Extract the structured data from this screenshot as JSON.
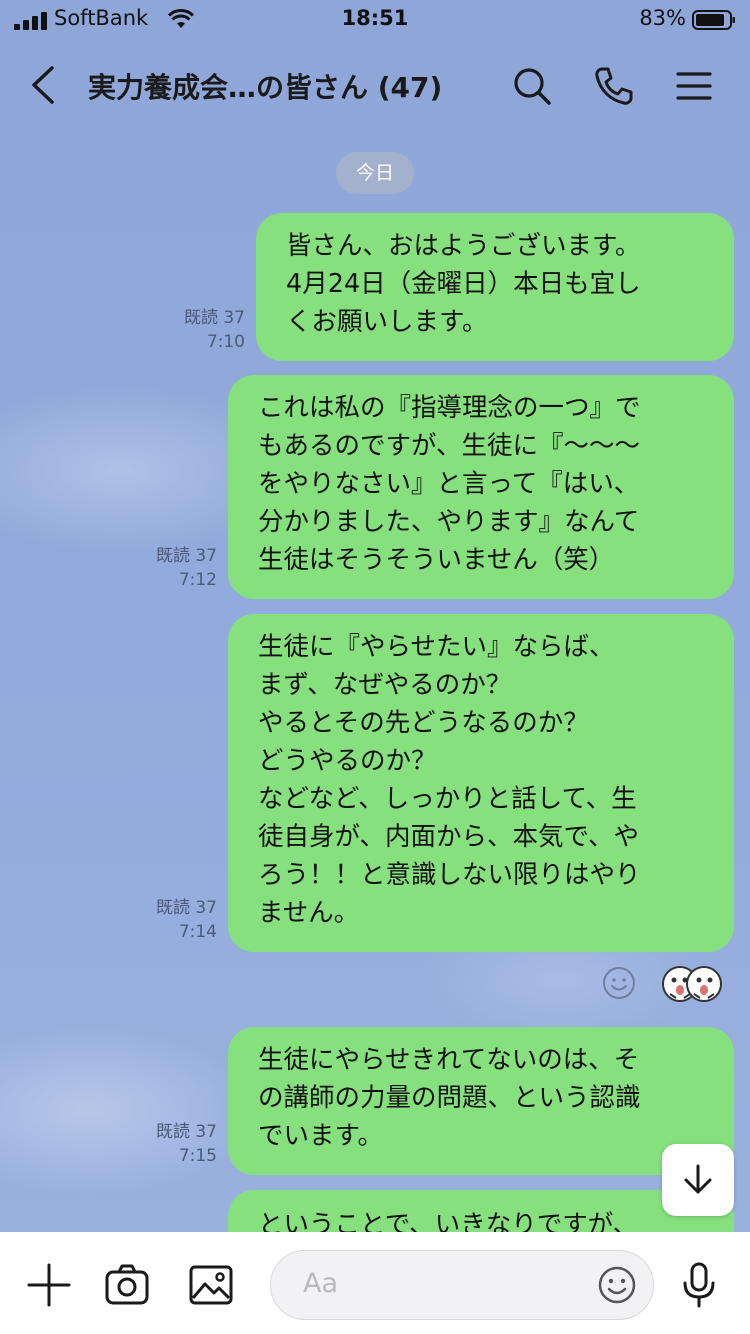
{
  "status_bar": {
    "carrier": "SoftBank",
    "time": "18:51",
    "battery": "83%"
  },
  "header": {
    "title": "実力養成会…の皆さん (47)"
  },
  "date_separator": "今日",
  "messages": [
    {
      "text": "皆さん、おはようございます。\n4月24日（金曜日）本日も宜し\nくお願いします。",
      "read": "既読 37",
      "time": "7:10"
    },
    {
      "text": "これは私の『指導理念の一つ』で\nもあるのですが、生徒に『〜〜〜\nをやりなさい』と言って『はい、\n分かりました、やります』なんて\n生徒はそうそういません（笑）",
      "read": "既読 37",
      "time": "7:12"
    },
    {
      "text": "生徒に『やらせたい』ならば、\nまず、なぜやるのか？\nやるとその先どうなるのか？\nどうやるのか？\nなどなど、しっかりと話して、生\n徒自身が、内面から、本気で、や\nろう！！と意識しない限りはやり\nません。",
      "read": "既読 37",
      "time": "7:14"
    },
    {
      "text": "生徒にやらせきれてないのは、そ\nの講師の力量の問題、という認識\nでいます。",
      "read": "既読 37",
      "time": "7:15"
    },
    {
      "text": "ということで、いきなりですが、"
    }
  ],
  "composer": {
    "placeholder": "Aa"
  },
  "colors": {
    "bubble": "#86e07e",
    "background": "#8fa8d9"
  },
  "icons": [
    "signal-icon",
    "wifi-icon",
    "battery-icon",
    "back-chevron-icon",
    "search-icon",
    "phone-icon",
    "menu-icon",
    "add-reaction-icon",
    "sticker-reaction-icon",
    "scroll-down-arrow-icon",
    "plus-icon",
    "camera-icon",
    "image-icon",
    "emoji-icon",
    "microphone-icon"
  ]
}
